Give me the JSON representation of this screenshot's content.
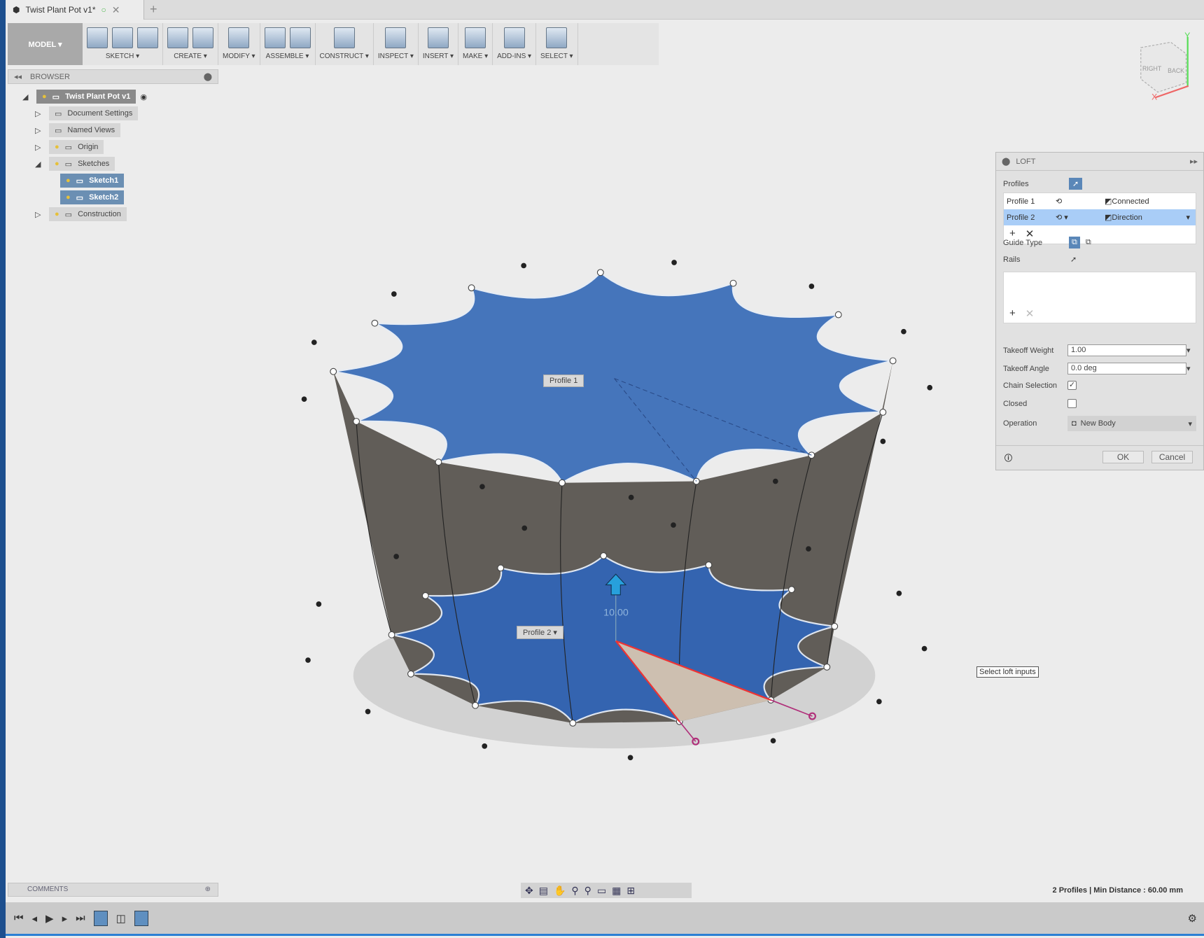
{
  "tab": {
    "title": "Twist Plant Pot v1*",
    "close": "✕",
    "new": "+"
  },
  "toolbar": {
    "mode": "MODEL ▾",
    "groups": [
      {
        "label": "SKETCH ▾",
        "icons": [
          "create-sketch-icon",
          "spline-icon",
          "rectangle-icon"
        ]
      },
      {
        "label": "CREATE ▾",
        "icons": [
          "extrude-icon",
          "form-icon"
        ]
      },
      {
        "label": "MODIFY ▾",
        "icons": [
          "press-pull-icon"
        ]
      },
      {
        "label": "ASSEMBLE ▾",
        "icons": [
          "new-component-icon",
          "joint-icon"
        ]
      },
      {
        "label": "CONSTRUCT ▾",
        "icons": [
          "offset-plane-icon"
        ]
      },
      {
        "label": "INSPECT ▾",
        "icons": [
          "measure-icon"
        ]
      },
      {
        "label": "INSERT ▾",
        "icons": [
          "insert-image-icon"
        ]
      },
      {
        "label": "MAKE ▾",
        "icons": [
          "3d-print-icon"
        ]
      },
      {
        "label": "ADD-INS ▾",
        "icons": [
          "scripts-icon"
        ]
      },
      {
        "label": "SELECT ▾",
        "icons": [
          "select-icon"
        ]
      }
    ]
  },
  "browser": {
    "title": "BROWSER",
    "items": [
      {
        "label": "Twist Plant Pot v1",
        "expander": "◢",
        "icon": "component-icon"
      },
      {
        "label": "Document Settings",
        "expander": "▷",
        "icon": "gear-icon"
      },
      {
        "label": "Named Views",
        "expander": "▷",
        "icon": "folder-icon"
      },
      {
        "label": "Origin",
        "expander": "▷",
        "icon": "folder-icon"
      },
      {
        "label": "Sketches",
        "expander": "◢",
        "icon": "folder-icon"
      },
      {
        "label": "Sketch1",
        "expander": "",
        "icon": "sketch-icon"
      },
      {
        "label": "Sketch2",
        "expander": "",
        "icon": "sketch-icon"
      },
      {
        "label": "Construction",
        "expander": "▷",
        "icon": "folder-icon"
      }
    ]
  },
  "viewcube": {
    "right": "RIGHT",
    "back": "BACK",
    "x": "X",
    "y": "Y"
  },
  "viewport": {
    "profile1": "Profile 1",
    "profile2": "Profile 2 ▾",
    "dimension": "10.00",
    "tooltip": "Select loft inputs"
  },
  "loft": {
    "title": "LOFT",
    "profiles_label": "Profiles",
    "profiles": [
      {
        "name": "Profile 1",
        "condition": "Connected"
      },
      {
        "name": "Profile 2",
        "condition": "Direction"
      }
    ],
    "guide_type_label": "Guide Type",
    "rails_label": "Rails",
    "takeoff_weight_label": "Takeoff Weight",
    "takeoff_weight": "1.00",
    "takeoff_angle_label": "Takeoff Angle",
    "takeoff_angle": "0.0 deg",
    "chain_selection_label": "Chain Selection",
    "chain_selection": true,
    "closed_label": "Closed",
    "closed": false,
    "operation_label": "Operation",
    "operation": "New Body",
    "ok": "OK",
    "cancel": "Cancel"
  },
  "comments": {
    "title": "COMMENTS"
  },
  "status": "2 Profiles | Min Distance : 60.00 mm",
  "colors": {
    "face": "#3f6fb8",
    "wall": "#6a6660",
    "accent": "#6b8fb3",
    "selected_row": "#a9cdf7"
  }
}
